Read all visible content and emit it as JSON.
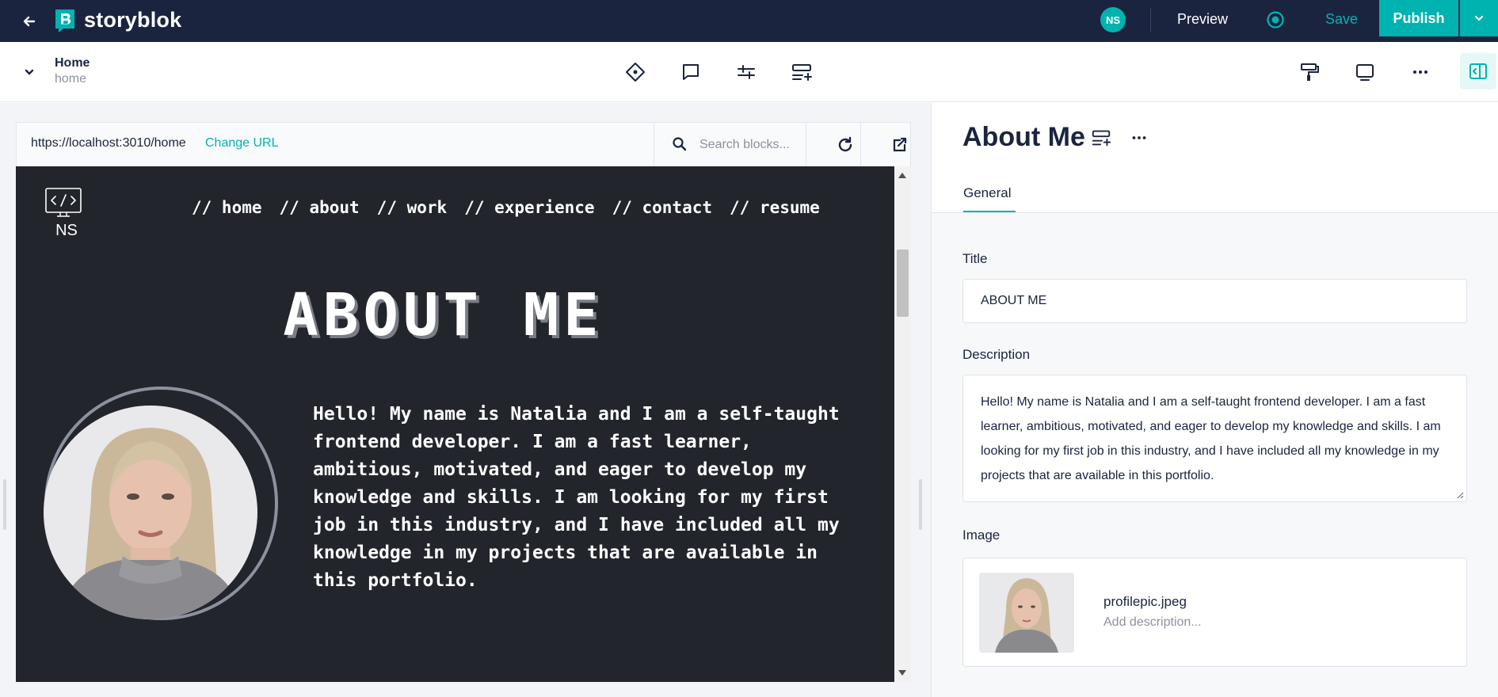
{
  "app": {
    "brand": "storyblok",
    "user_initials": "NS",
    "preview_label": "Preview",
    "save_label": "Save",
    "publish_label": "Publish",
    "accent_color": "#00b3b0",
    "topbar_color": "#1b243f"
  },
  "story": {
    "name": "Home",
    "slug": "home"
  },
  "toolbar": {
    "icons": [
      "diamond-icon",
      "comment-icon",
      "sliders-icon",
      "add-block-icon",
      "paint-roller-icon",
      "device-preview-icon",
      "more-icon",
      "side-panel-icon"
    ]
  },
  "preview": {
    "url": "https://localhost:3010/home",
    "change_url_label": "Change URL",
    "search_placeholder": "Search blocks...",
    "site": {
      "logo_initials": "NS",
      "nav": [
        "// home",
        "// about",
        "// work",
        "// experience",
        "// contact",
        "// resume"
      ],
      "heading": "ABOUT ME",
      "text": "Hello! My name is Natalia and I am a self-taught frontend developer. I am a fast learner, ambitious, motivated, and eager to develop my knowledge and skills. I am looking for my first job in this industry, and I have included all my knowledge in my projects that are available in this portfolio."
    }
  },
  "panel": {
    "title": "About Me",
    "tab_general": "General",
    "fields": {
      "title_label": "Title",
      "title_value": "ABOUT ME",
      "description_label": "Description",
      "description_value": "Hello! My name is Natalia and I am a self-taught frontend developer. I am a fast learner, ambitious, motivated, and eager to develop my knowledge and skills. I am looking for my first job in this industry, and I have included all my knowledge in my projects that are available in this portfolio.",
      "image_label": "Image",
      "image_filename": "profilepic.jpeg",
      "image_description_placeholder": "Add description..."
    }
  }
}
